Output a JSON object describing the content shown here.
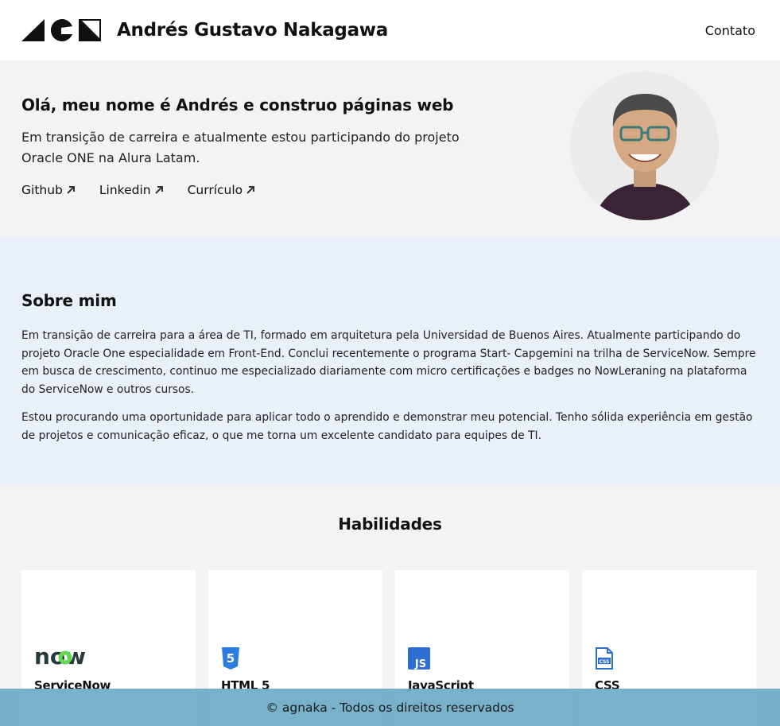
{
  "header": {
    "name": "Andrés Gustavo Nakagawa",
    "nav_contact": "Contato"
  },
  "hero": {
    "title": "Olá, meu nome é Andrés e construo páginas web",
    "text": "Em transição de carreira e atualmente estou participando do projeto Oracle ONE na Alura Latam.",
    "links": [
      {
        "label": "Github",
        "icon": "arrow-up-right-icon"
      },
      {
        "label": "Linkedin",
        "icon": "arrow-up-right-icon"
      },
      {
        "label": "Currículo",
        "icon": "arrow-up-right-icon"
      }
    ]
  },
  "about": {
    "title": "Sobre mim",
    "paragraphs": [
      "Em transição de carreira para a área de TI, formado em arquitetura pela Universidad de Buenos Aires. Atualmente participando do projeto Oracle One especialidade em Front-End. Conclui recentemente o programa Start- Capgemini na trilha de ServiceNow. Sempre em busca de crescimento, continuo me especializado diariamente com micro certificações e badges no NowLeraning na plataforma do ServiceNow e outros cursos.",
      "Estou procurando uma oportunidade para aplicar todo o aprendido e demonstrar meu potencial. Tenho sólida experiência em gestão de projetos e comunicação eficaz, o que me torna um excelente candidato para equipes de TI."
    ]
  },
  "skills": {
    "title": "Habilidades",
    "items": [
      {
        "label": "ServiceNow",
        "icon": "servicenow-logo-icon",
        "logo_text": "now"
      },
      {
        "label": "HTML 5",
        "icon": "html5-icon",
        "logo_text": "5"
      },
      {
        "label": "JavaScript",
        "icon": "javascript-icon",
        "logo_text": "JS"
      },
      {
        "label": "CSS",
        "icon": "css-file-icon",
        "logo_text": "CSS"
      }
    ]
  },
  "footer": {
    "text": "© agnaka - Todos os direitos reservados"
  },
  "colors": {
    "header_bg": "#ffffff",
    "hero_bg": "#f3f3f3",
    "about_bg": "#e9f0fa",
    "footer_bg": "#6eaac6",
    "servicenow_green": "#62d84e",
    "html5_blue": "#2b7de0",
    "js_blue": "#2d6fd0"
  }
}
